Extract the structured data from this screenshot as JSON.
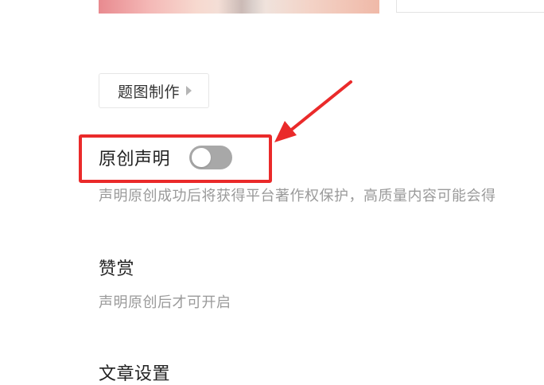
{
  "cover": {
    "image_name": "cover-image"
  },
  "cover_tool": {
    "label": "题图制作",
    "icon": "chevron-right-icon"
  },
  "original": {
    "title": "原创声明",
    "toggle_on": false,
    "description": "声明原创成功后将获得平台著作权保护，高质量内容可能会得"
  },
  "reward": {
    "title": "赞赏",
    "description": "声明原创后才可开启"
  },
  "article_settings": {
    "title": "文章设置"
  },
  "annotation": {
    "highlight_color": "#ea2a2a"
  },
  "colors": {
    "toggle_off": "#a8a8a8",
    "muted_text": "#9a9a9a",
    "primary_text": "#222222"
  }
}
